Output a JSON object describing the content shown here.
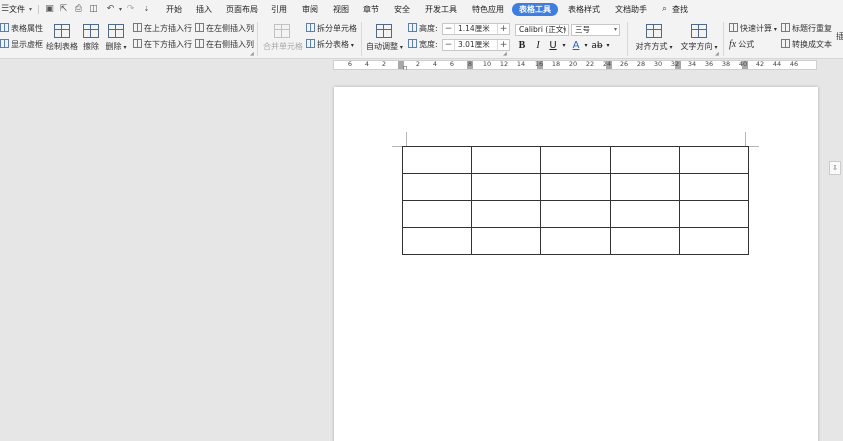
{
  "menubar": {
    "file_label": "文件",
    "tabs": [
      "开始",
      "插入",
      "页面布局",
      "引用",
      "审阅",
      "视图",
      "章节",
      "安全",
      "开发工具",
      "特色应用"
    ],
    "active_tab": "表格工具",
    "tabs_after": [
      "表格样式",
      "文档助手"
    ],
    "search_label": "查找"
  },
  "ribbon": {
    "table_properties": "表格属性",
    "show_gridlines": "显示虚框",
    "draw_table": "绘制表格",
    "erase": "擦除",
    "delete": "删除",
    "insert_row_above": "在上方插入行",
    "insert_row_below": "在下方插入行",
    "insert_col_left": "在左侧插入列",
    "insert_col_right": "在右侧插入列",
    "merge_cells": "合并单元格",
    "split_cells": "拆分单元格",
    "split_table": "拆分表格",
    "auto_fit": "自动调整",
    "height_label": "高度:",
    "height_value": "1.14厘米",
    "width_label": "宽度:",
    "width_value": "3.01厘米",
    "font_name": "Calibri (正文)",
    "font_size": "三号",
    "bold": "B",
    "italic": "I",
    "underline": "U",
    "font_color": "A",
    "align": "对齐方式",
    "text_direction": "文字方向",
    "quick_calc": "快速计算",
    "formula": "公式",
    "repeat_header": "标题行重复",
    "to_text": "转换成文本",
    "overflow": "插"
  },
  "ruler": {
    "labels": [
      "6",
      "4",
      "2",
      "2",
      "4",
      "6",
      "8",
      "10",
      "12",
      "14",
      "16",
      "18",
      "20",
      "22",
      "24",
      "26",
      "28",
      "30",
      "32",
      "34",
      "36",
      "38",
      "40",
      "42",
      "44",
      "46"
    ]
  },
  "table": {
    "rows": 4,
    "cols": 5
  }
}
